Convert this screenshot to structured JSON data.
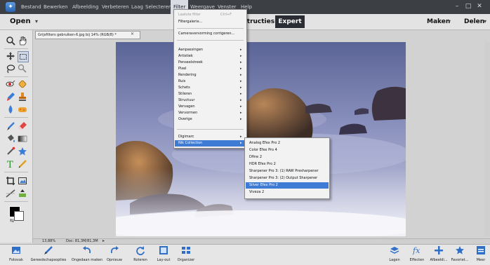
{
  "menubar": {
    "items": [
      "Bestand",
      "Bewerken",
      "Afbeelding",
      "Verbeteren",
      "Laag",
      "Selecteren",
      "Filter",
      "Weergave",
      "Venster",
      "Help"
    ],
    "active": "Filter"
  },
  "modebar": {
    "open_label": "Open",
    "mode_partial": "nstructies",
    "mode_expert": "Expert",
    "maken_label": "Maken",
    "delen_label": "Delen"
  },
  "document": {
    "tab_title": "Grijsfilters gebruiken-6.jpg bij 14% (RGB/8) *",
    "zoom": "13,88%",
    "size": "Doc: 81,3M/81,3M"
  },
  "filter_menu": {
    "items": [
      {
        "label": "Laatste filter",
        "shortcut": "Ctrl+F",
        "disabled": true
      },
      {
        "label": "Filtergalerie...",
        "shortcut": "",
        "disabled": false
      },
      {
        "label": "Cameravervorming corrigeren...",
        "shortcut": "",
        "disabled": false
      },
      {
        "label": "Aanpassingen",
        "submenu": true
      },
      {
        "label": "Artistiek",
        "submenu": true
      },
      {
        "label": "Penseelstreek",
        "submenu": true
      },
      {
        "label": "Pixel",
        "submenu": true
      },
      {
        "label": "Rendering",
        "submenu": true
      },
      {
        "label": "Ruis",
        "submenu": true
      },
      {
        "label": "Schets",
        "submenu": true
      },
      {
        "label": "Stileren",
        "submenu": true
      },
      {
        "label": "Structuur",
        "submenu": true
      },
      {
        "label": "Vervagen",
        "submenu": true
      },
      {
        "label": "Vervormen",
        "submenu": true
      },
      {
        "label": "Overige",
        "submenu": true
      },
      {
        "label": "Digimarc",
        "submenu": true
      },
      {
        "label": "Nik Collection",
        "submenu": true,
        "selected": true
      }
    ]
  },
  "nik_submenu": {
    "items": [
      {
        "label": "Analog Efex Pro 2"
      },
      {
        "label": "Color Efex Pro 4"
      },
      {
        "label": "Dfine 2"
      },
      {
        "label": "HDR Efex Pro 2"
      },
      {
        "label": "Sharpener Pro 3: (1) RAW Presharpener"
      },
      {
        "label": "Sharpener Pro 3: (2) Output Sharpener"
      },
      {
        "label": "Silver Efex Pro 2",
        "selected": true
      },
      {
        "label": "Viveza 2"
      }
    ]
  },
  "taskbar_left": [
    "Fotovak",
    "Gereedschapsopties",
    "Ongedaan maken",
    "Opnieuw",
    "Roteren",
    "Lay-out",
    "Organizer"
  ],
  "taskbar_right": [
    "Lagen",
    "Effecten",
    "Afbeeldi...",
    "Favoriet...",
    "Meer"
  ],
  "colors": {
    "menu_highlight": "#3d7bd5",
    "chrome_dark": "#3c3f44",
    "photo_base": "#6f78a4"
  },
  "icons": {
    "toolbox": [
      "zoom-icon",
      "hand-icon",
      "move-icon",
      "marquee-icon",
      "lasso-icon",
      "magic-wand-icon",
      "red-eye-icon",
      "spot-healing-icon",
      "smart-brush-icon",
      "clone-stamp-icon",
      "blur-icon",
      "sponge-icon",
      "brush-icon",
      "eraser-icon",
      "paint-bucket-icon",
      "gradient-icon",
      "eyedropper-icon",
      "custom-shape-icon",
      "type-icon",
      "pencil-icon",
      "crop-icon",
      "recompose-icon",
      "straighten-icon",
      "content-aware-move-icon"
    ]
  }
}
